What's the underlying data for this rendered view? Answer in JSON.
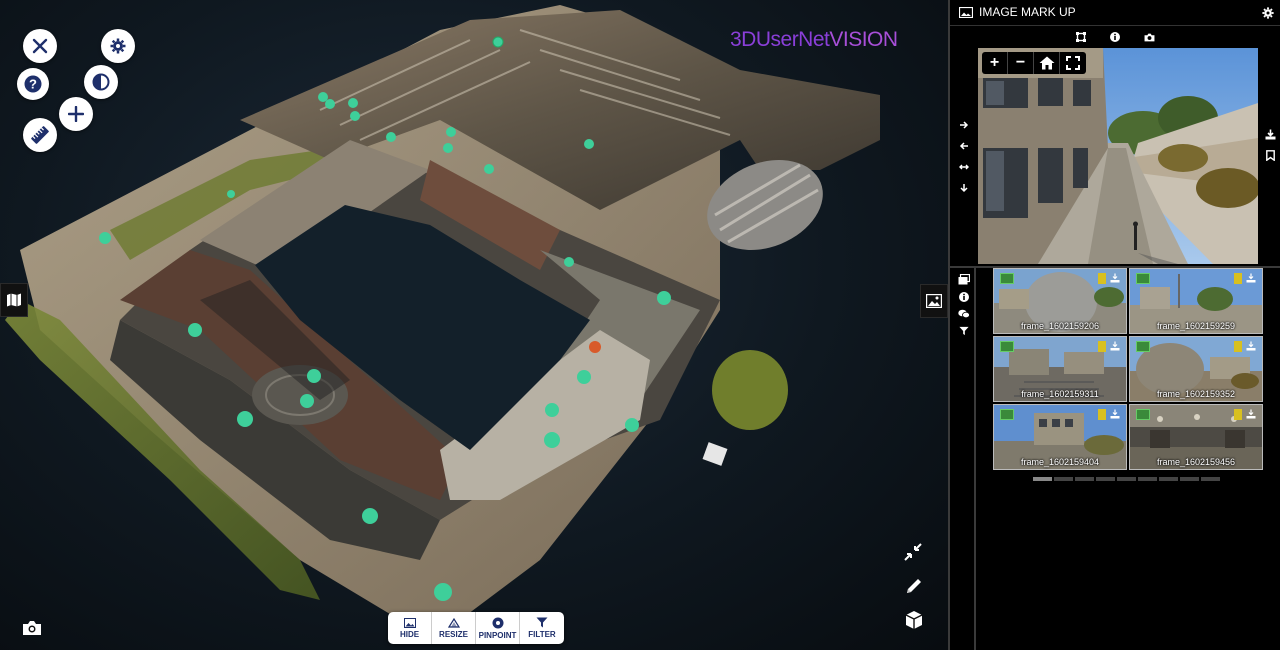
{
  "viewport": {
    "logo_part1": "3DUserNet",
    "logo_part2": "VISION",
    "buttons": {
      "close_icon": "close-icon",
      "settings_icon": "gear-icon",
      "help_icon": "question-icon",
      "contrast_icon": "contrast-icon",
      "add_icon": "plus-icon",
      "measure_icon": "ruler-icon"
    },
    "bottom_toolbar": [
      {
        "label": "HIDE",
        "icon": "image-icon"
      },
      {
        "label": "RESIZE",
        "icon": "resize-icon"
      },
      {
        "label": "PINPOINT",
        "icon": "pinpoint-icon"
      },
      {
        "label": "FILTER",
        "icon": "filter-icon"
      }
    ]
  },
  "panel": {
    "title": "IMAGE MARK UP",
    "thumbnails": [
      {
        "label": "frame_1602159206"
      },
      {
        "label": "frame_1602159259"
      },
      {
        "label": "frame_1602159311"
      },
      {
        "label": "frame_1602159352"
      },
      {
        "label": "frame_1602159404"
      },
      {
        "label": "frame_1602159456"
      }
    ],
    "viewer_controls": [
      {
        "label": "+"
      },
      {
        "label": "−"
      }
    ]
  },
  "colors": {
    "accent_purple": "#8a3fd8",
    "toolbar_text": "#1e2f6b",
    "marker_green": "#3ecf9a"
  }
}
